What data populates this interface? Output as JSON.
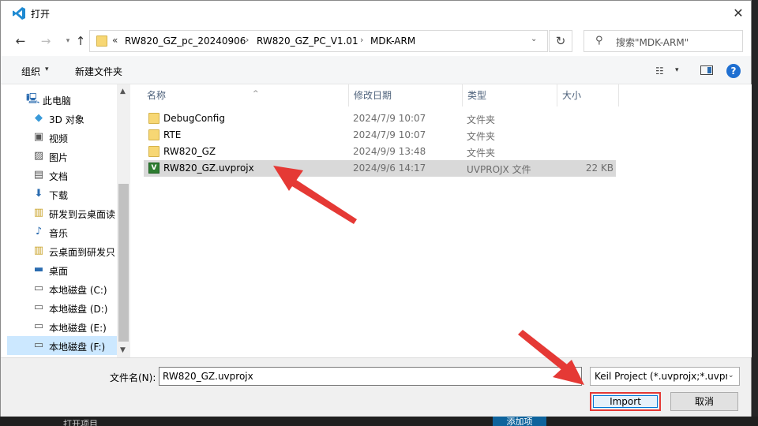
{
  "window": {
    "title": "打开",
    "close_glyph": "✕"
  },
  "nav": {
    "back_glyph": "←",
    "forward_glyph": "→",
    "recent_glyph": "▾",
    "up_glyph": "↑",
    "chevron": "«",
    "breadcrumbs": [
      "RW820_GZ_pc_20240906",
      "RW820_GZ_PC_V1.01",
      "MDK-ARM"
    ],
    "crumb_sep": "›",
    "dropdown_glyph": "⌄",
    "refresh_glyph": "↻"
  },
  "search": {
    "placeholder": "搜索\"MDK-ARM\"",
    "icon_glyph": "⚲"
  },
  "toolbar": {
    "organize_label": "组织",
    "organize_arrow": "▾",
    "new_folder_label": "新建文件夹",
    "view_glyph": "☷",
    "view_arrow": "▾",
    "help_glyph": "?"
  },
  "sidebar": {
    "items": [
      {
        "label": "此电脑",
        "icon": "pc-icon",
        "glyph": "🖳"
      },
      {
        "label": "3D 对象",
        "icon": "3d-objects-icon",
        "glyph": "◆"
      },
      {
        "label": "视频",
        "icon": "video-icon",
        "glyph": "▣"
      },
      {
        "label": "图片",
        "icon": "pictures-icon",
        "glyph": "▨"
      },
      {
        "label": "文档",
        "icon": "documents-icon",
        "glyph": "▤"
      },
      {
        "label": "下载",
        "icon": "download-icon",
        "glyph": "⬇"
      },
      {
        "label": "研发到云桌面读",
        "icon": "shared-folder-icon",
        "glyph": "▥"
      },
      {
        "label": "音乐",
        "icon": "music-icon",
        "glyph": "♪"
      },
      {
        "label": "云桌面到研发只",
        "icon": "shared-folder-icon",
        "glyph": "▥"
      },
      {
        "label": "桌面",
        "icon": "desktop-icon",
        "glyph": "▬"
      },
      {
        "label": "本地磁盘 (C:)",
        "icon": "drive-c-icon",
        "glyph": "▭"
      },
      {
        "label": "本地磁盘 (D:)",
        "icon": "drive-icon",
        "glyph": "▭"
      },
      {
        "label": "本地磁盘 (E:)",
        "icon": "drive-icon",
        "glyph": "▭"
      },
      {
        "label": "本地磁盘 (F:)",
        "icon": "drive-icon",
        "glyph": "▭",
        "selected": true
      }
    ],
    "scroll_up_glyph": "▲",
    "scroll_down_glyph": "▼"
  },
  "columns": {
    "name": "名称",
    "date": "修改日期",
    "type": "类型",
    "size": "大小",
    "sort_glyph": "^"
  },
  "files": [
    {
      "name": "DebugConfig",
      "date": "2024/7/9 10:07",
      "type": "文件夹",
      "size": "",
      "kind": "folder"
    },
    {
      "name": "RTE",
      "date": "2024/7/9 10:07",
      "type": "文件夹",
      "size": "",
      "kind": "folder"
    },
    {
      "name": "RW820_GZ",
      "date": "2024/9/9 13:48",
      "type": "文件夹",
      "size": "",
      "kind": "folder"
    },
    {
      "name": "RW820_GZ.uvprojx",
      "date": "2024/9/6 14:17",
      "type": "UVPROJX 文件",
      "size": "22 KB",
      "kind": "project",
      "selected": true,
      "icon_glyph": "V"
    }
  ],
  "footer": {
    "filename_label": "文件名(N):",
    "filename_value": "RW820_GZ.uvprojx",
    "filetype_value": "Keil Project (*.uvprojx;*.uvproj)",
    "filetype_arrow": "⌄",
    "import_label": "Import",
    "cancel_label": "取消"
  },
  "background": {
    "bottom_left_text": "打开项目",
    "bottom_button": "添加项"
  },
  "colors": {
    "accent": "#0078d7",
    "annotation_red": "#e53935",
    "selection": "#cce8ff",
    "folder": "#f7d774"
  }
}
